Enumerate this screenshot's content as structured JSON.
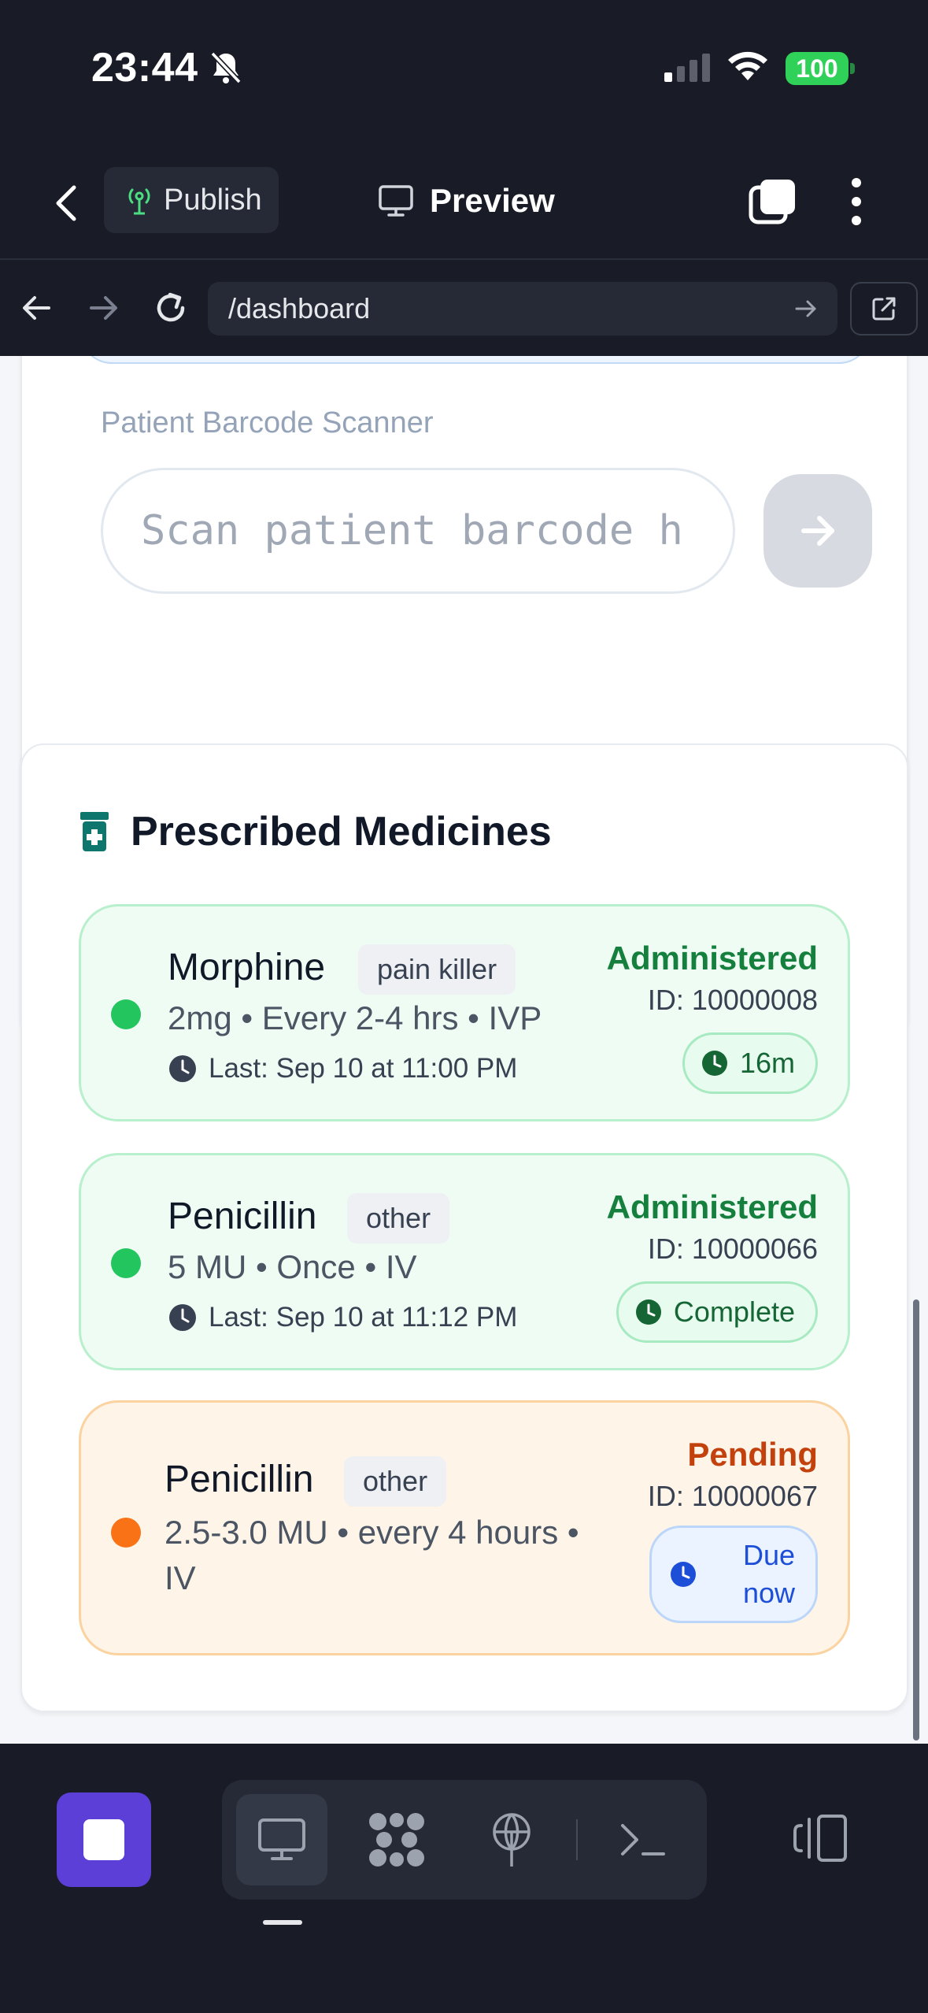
{
  "status_bar": {
    "time": "23:44",
    "battery": "100"
  },
  "toolbar": {
    "publish_label": "Publish",
    "preview_label": "Preview"
  },
  "browser": {
    "url": "/dashboard"
  },
  "scanner": {
    "label": "Patient Barcode Scanner",
    "placeholder": "Scan patient barcode h"
  },
  "medicines": {
    "title": "Prescribed Medicines",
    "items": [
      {
        "name": "Morphine",
        "tag": "pain killer",
        "dose": "2mg • Every 2-4 hrs • IVP",
        "last": "Last: Sep 10 at 11:00 PM",
        "status": "Administered",
        "id": "ID: 10000008",
        "timer": "16m",
        "status_color": "#15803d",
        "dot_color": "#22c55e"
      },
      {
        "name": "Penicillin",
        "tag": "other",
        "dose": "5 MU • Once • IV",
        "last": "Last: Sep 10 at 11:12 PM",
        "status": "Administered",
        "id": "ID: 10000066",
        "timer": "Complete",
        "status_color": "#15803d",
        "dot_color": "#22c55e"
      },
      {
        "name": "Penicillin",
        "tag": "other",
        "dose_line1": "2.5-3.0 MU • every 4 hours •",
        "dose_line2": "IV",
        "status": "Pending",
        "id": "ID: 10000067",
        "due_line1": "Due",
        "due_line2": "now",
        "status_color": "#c2410c",
        "dot_color": "#f97316"
      }
    ]
  },
  "colors": {
    "chrome_bg": "#191c26",
    "accent_purple": "#5b3fd6",
    "success_green": "#15803d",
    "pending_orange": "#c2410c",
    "info_blue": "#1d4ed8"
  }
}
